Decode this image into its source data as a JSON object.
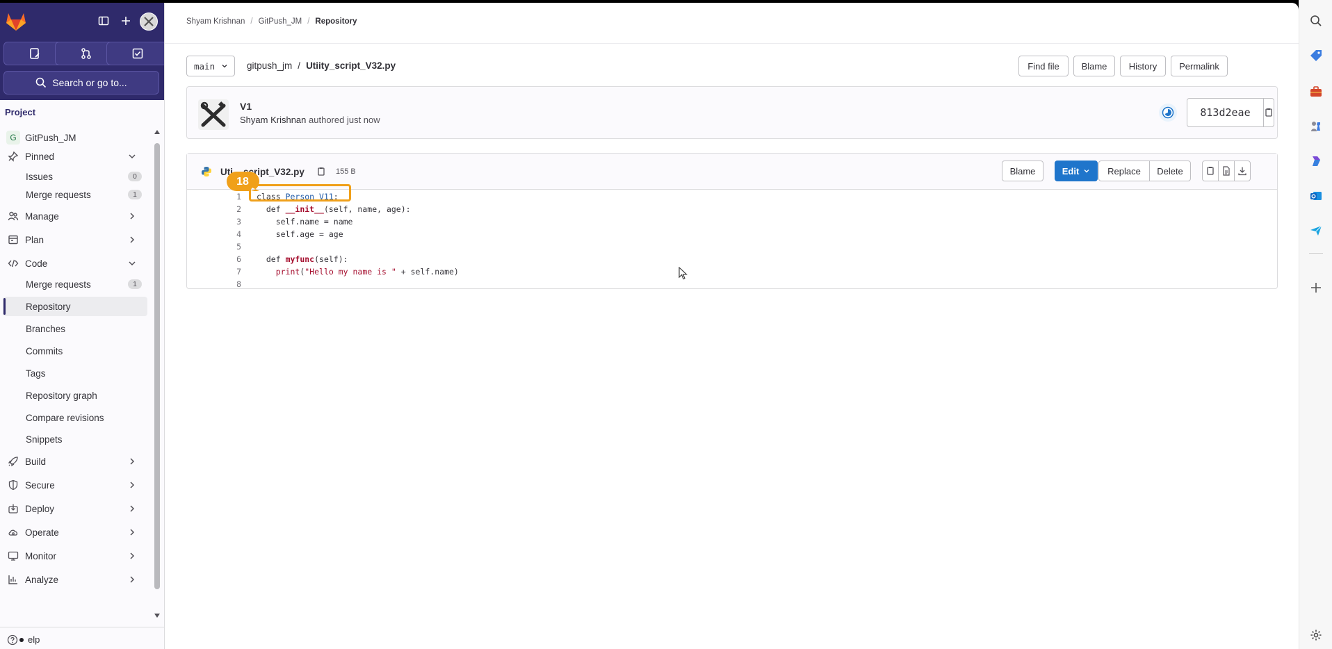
{
  "sidebar": {
    "search_label": "Search or go to...",
    "section_label": "Project",
    "project": {
      "badge": "G",
      "label": "GitPush_JM"
    },
    "pinned": {
      "label": "Pinned",
      "items": [
        {
          "label": "Issues",
          "count": "0"
        },
        {
          "label": "Merge requests",
          "count": "1"
        }
      ]
    },
    "manage_label": "Manage",
    "plan_label": "Plan",
    "code": {
      "label": "Code",
      "items": [
        {
          "label": "Merge requests",
          "count": "1"
        },
        {
          "label": "Repository"
        },
        {
          "label": "Branches"
        },
        {
          "label": "Commits"
        },
        {
          "label": "Tags"
        },
        {
          "label": "Repository graph"
        },
        {
          "label": "Compare revisions"
        },
        {
          "label": "Snippets"
        }
      ]
    },
    "build_label": "Build",
    "secure_label": "Secure",
    "deploy_label": "Deploy",
    "operate_label": "Operate",
    "monitor_label": "Monitor",
    "analyze_label": "Analyze",
    "help_label": "elp"
  },
  "breadcrumb": [
    "Shyam Krishnan",
    "GitPush_JM",
    "Repository"
  ],
  "path_row": {
    "branch": "main",
    "repo": "gitpush_jm",
    "file": "Utiity_script_V32.py",
    "buttons": {
      "find_file": "Find file",
      "blame": "Blame",
      "history": "History",
      "permalink": "Permalink"
    }
  },
  "commit": {
    "title": "V1",
    "author": "Shyam Krishnan",
    "meta": "authored just now",
    "sha": "813d2eae"
  },
  "file": {
    "name": "Utiity_script_V32.py",
    "name_visible": "Uti",
    "name_tail": "script_V32.py",
    "size": "155 B",
    "buttons": {
      "blame": "Blame",
      "edit": "Edit",
      "replace": "Replace",
      "delete": "Delete"
    },
    "code_lines": [
      {
        "n": "1",
        "text": "class Person_V11:"
      },
      {
        "n": "2",
        "text": "  def __init__(self, name, age):"
      },
      {
        "n": "3",
        "text": "    self.name = name"
      },
      {
        "n": "4",
        "text": "    self.age = age"
      },
      {
        "n": "5",
        "text": ""
      },
      {
        "n": "6",
        "text": "  def myfunc(self):"
      },
      {
        "n": "7",
        "text": "    print(\"Hello my name is \" + self.name)"
      },
      {
        "n": "8",
        "text": ""
      }
    ]
  },
  "annotation": {
    "step": "18",
    "color": "#f0a01a"
  },
  "colors": {
    "brand_dark": "#2f2a6b",
    "primary": "#1f75cb"
  }
}
